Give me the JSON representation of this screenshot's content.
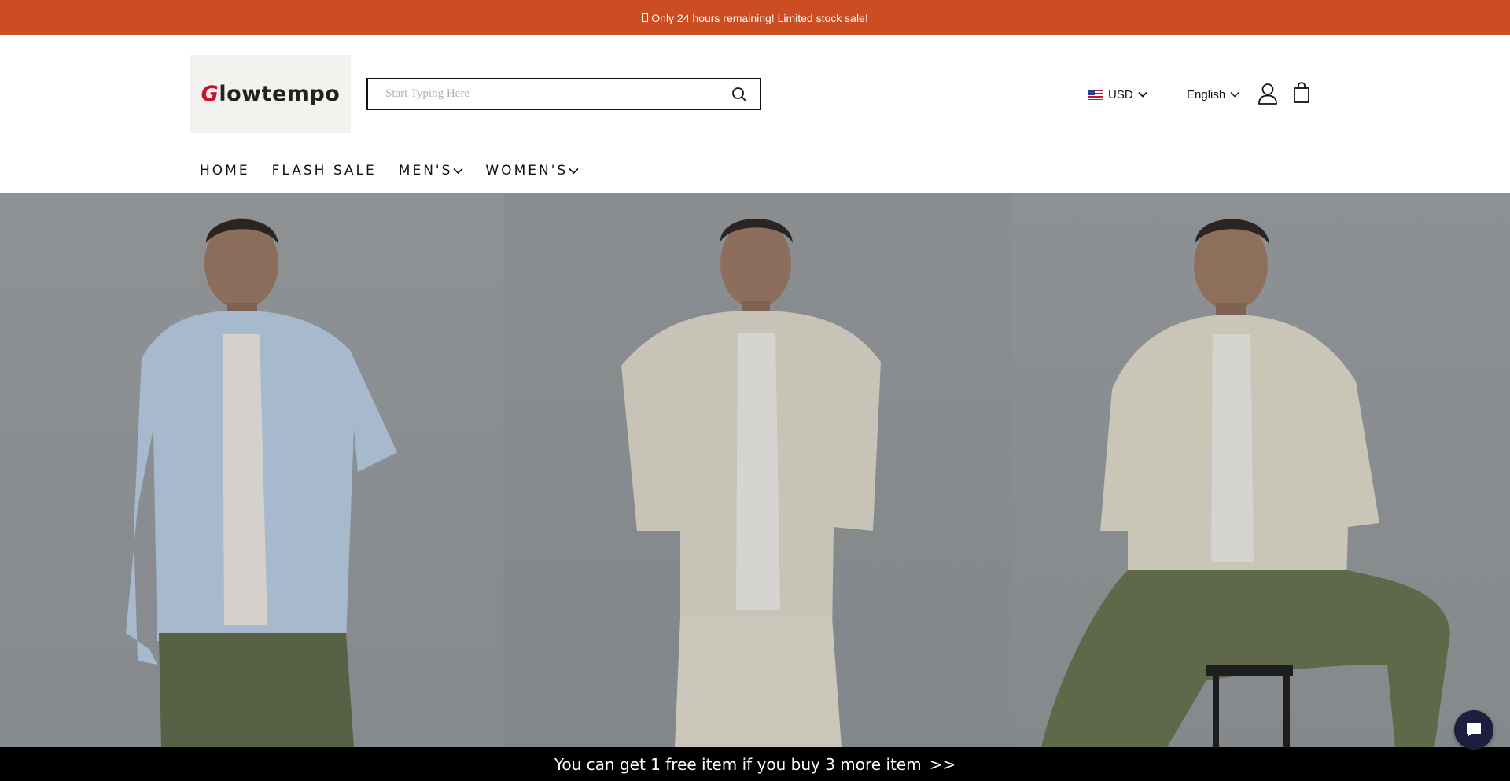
{
  "announcement": {
    "text": "Only 24 hours remaining! Limited stock sale!"
  },
  "header": {
    "logo_text_rest": "lowtempo",
    "logo_initial": "G",
    "search": {
      "placeholder": "Start Typing Here",
      "value": ""
    },
    "currency": {
      "label": "USD",
      "flag_icon": "us-flag-icon"
    },
    "language": {
      "label": "English"
    }
  },
  "nav": {
    "items": [
      {
        "label": "HOME",
        "has_dropdown": false
      },
      {
        "label": "FLASH SALE",
        "has_dropdown": false
      },
      {
        "label": "MEN'S",
        "has_dropdown": true
      },
      {
        "label": "WOMEN'S",
        "has_dropdown": true
      }
    ]
  },
  "promo": {
    "text": "You can get 1 free item if you buy 3 more item",
    "arrows": ">>"
  },
  "colors": {
    "announcement_bg": "#cc4d22",
    "promo_bg": "#000000",
    "chat_bg": "#1b1f3d"
  }
}
